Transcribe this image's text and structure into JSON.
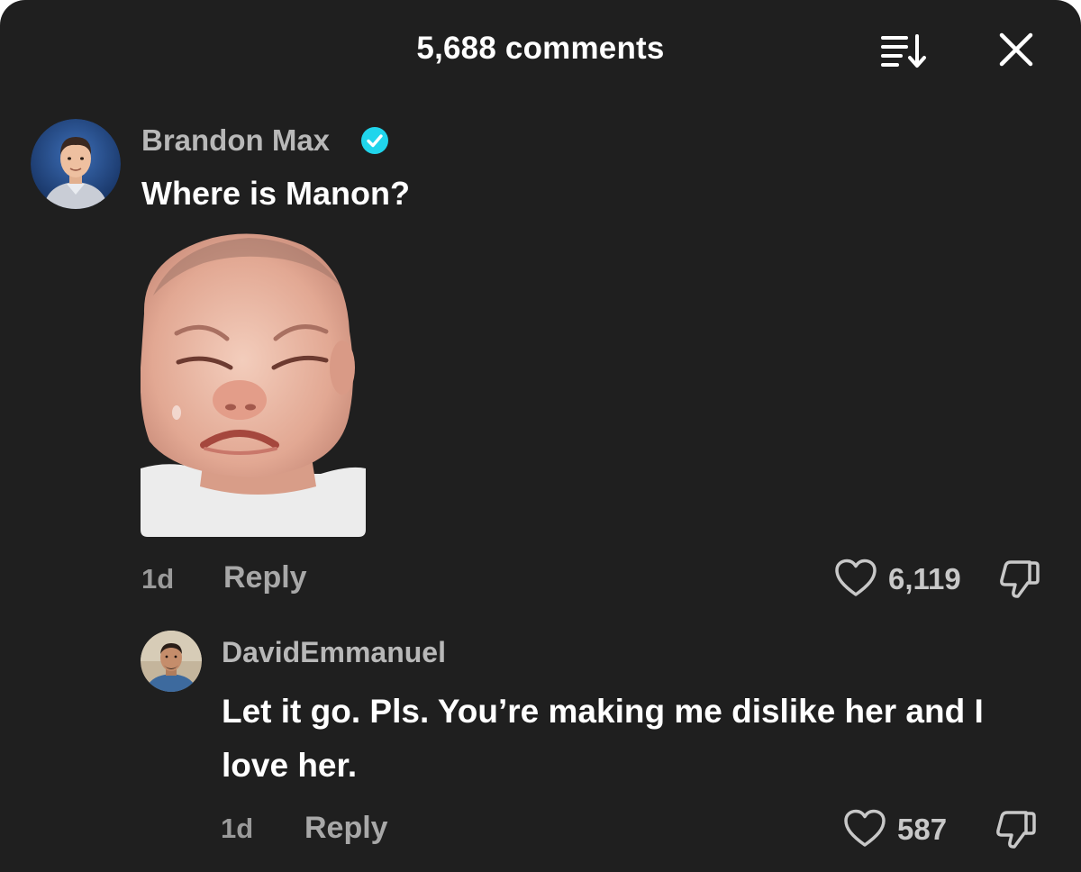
{
  "header": {
    "title": "5,688 comments",
    "sort_icon": "sort-icon",
    "close_icon": "close-icon"
  },
  "comments": [
    {
      "username": "Brandon Max",
      "verified": true,
      "text": "Where is Manon?",
      "has_sticker": true,
      "sticker_icon": "crying-baby-sticker",
      "time": "1d",
      "reply_label": "Reply",
      "likes": "6,119"
    },
    {
      "username": "DavidEmmanuel",
      "verified": false,
      "text": "Let it go. Pls. You’re making me dislike her and I love her.",
      "time": "1d",
      "reply_label": "Reply",
      "likes": "587"
    }
  ],
  "colors": {
    "background": "#1f1f1f",
    "text_primary": "#ffffff",
    "text_secondary": "#a8a8a8",
    "verified_badge": "#20d5ec"
  }
}
